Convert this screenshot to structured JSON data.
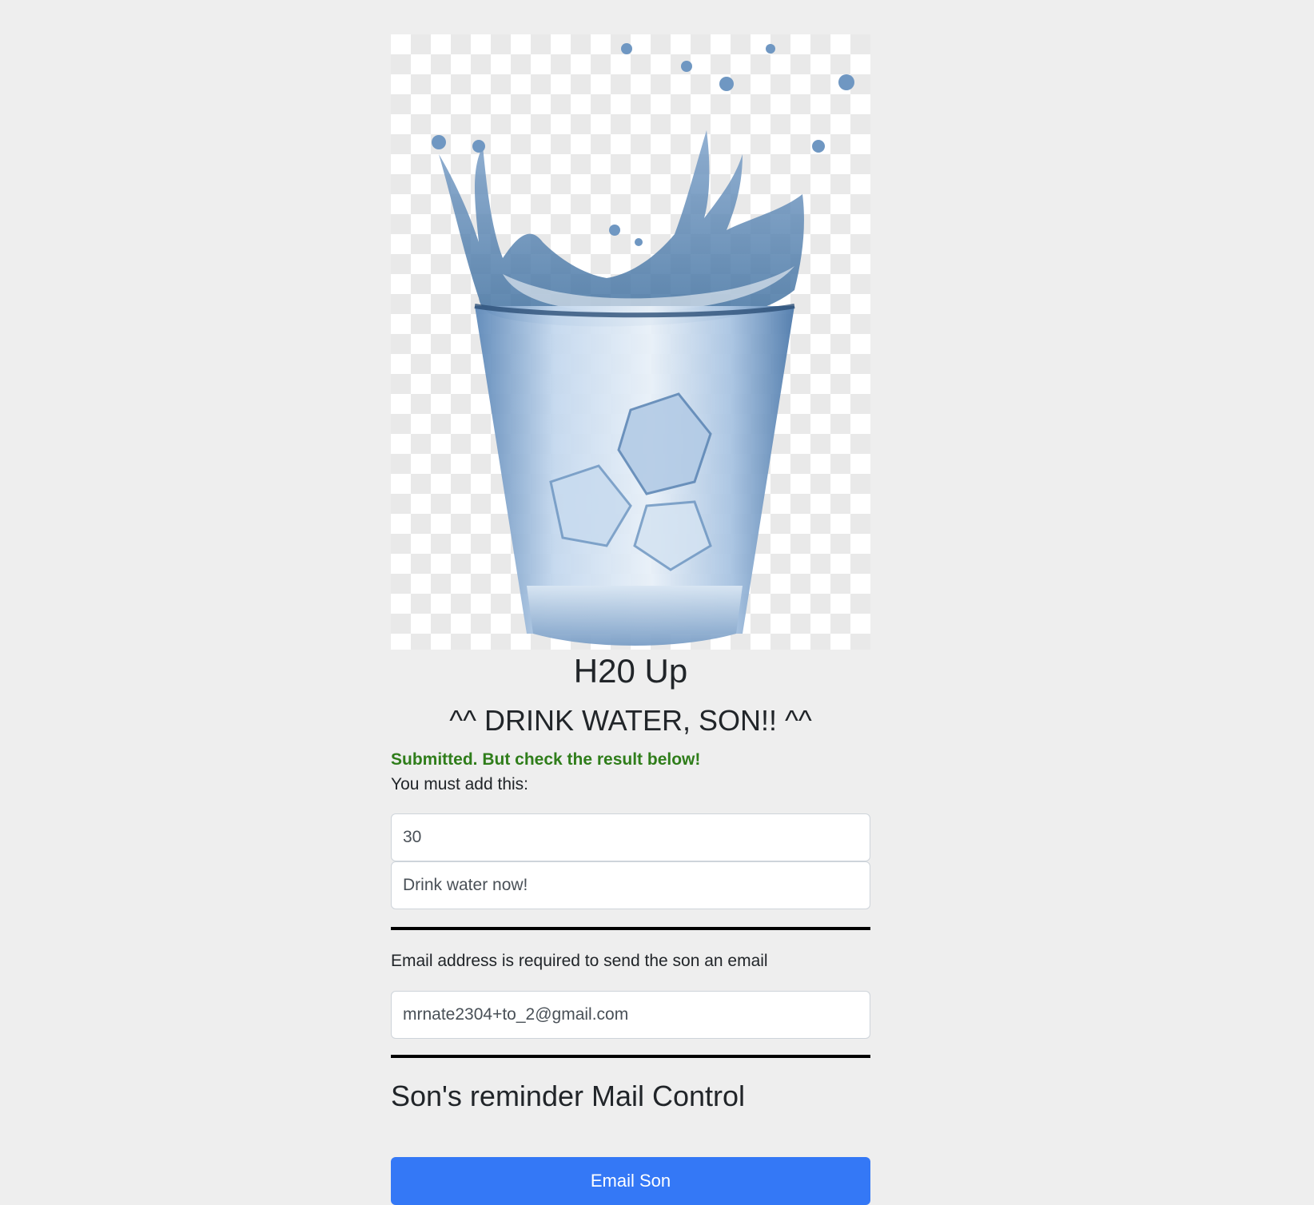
{
  "hero": {
    "image": "glass-of-water-splash",
    "colors": {
      "water_dark": "#3f6f9e",
      "water_light": "#c9dcef"
    }
  },
  "header": {
    "title": "H20 Up",
    "subtitle": "^^ DRINK WATER, SON!! ^^"
  },
  "status": {
    "message": "Submitted. But check the result below!",
    "color": "#2f7d1a"
  },
  "reminder_form": {
    "hint": "You must add this:",
    "interval_value": "30",
    "message_value": "Drink water now!"
  },
  "email_form": {
    "hint": "Email address is required to send the son an email",
    "email_value": "mrnate2304+to_2@gmail.com"
  },
  "mail_control": {
    "title": "Son's reminder Mail Control",
    "button_label": "Email Son",
    "button_color": "#3478f6"
  }
}
